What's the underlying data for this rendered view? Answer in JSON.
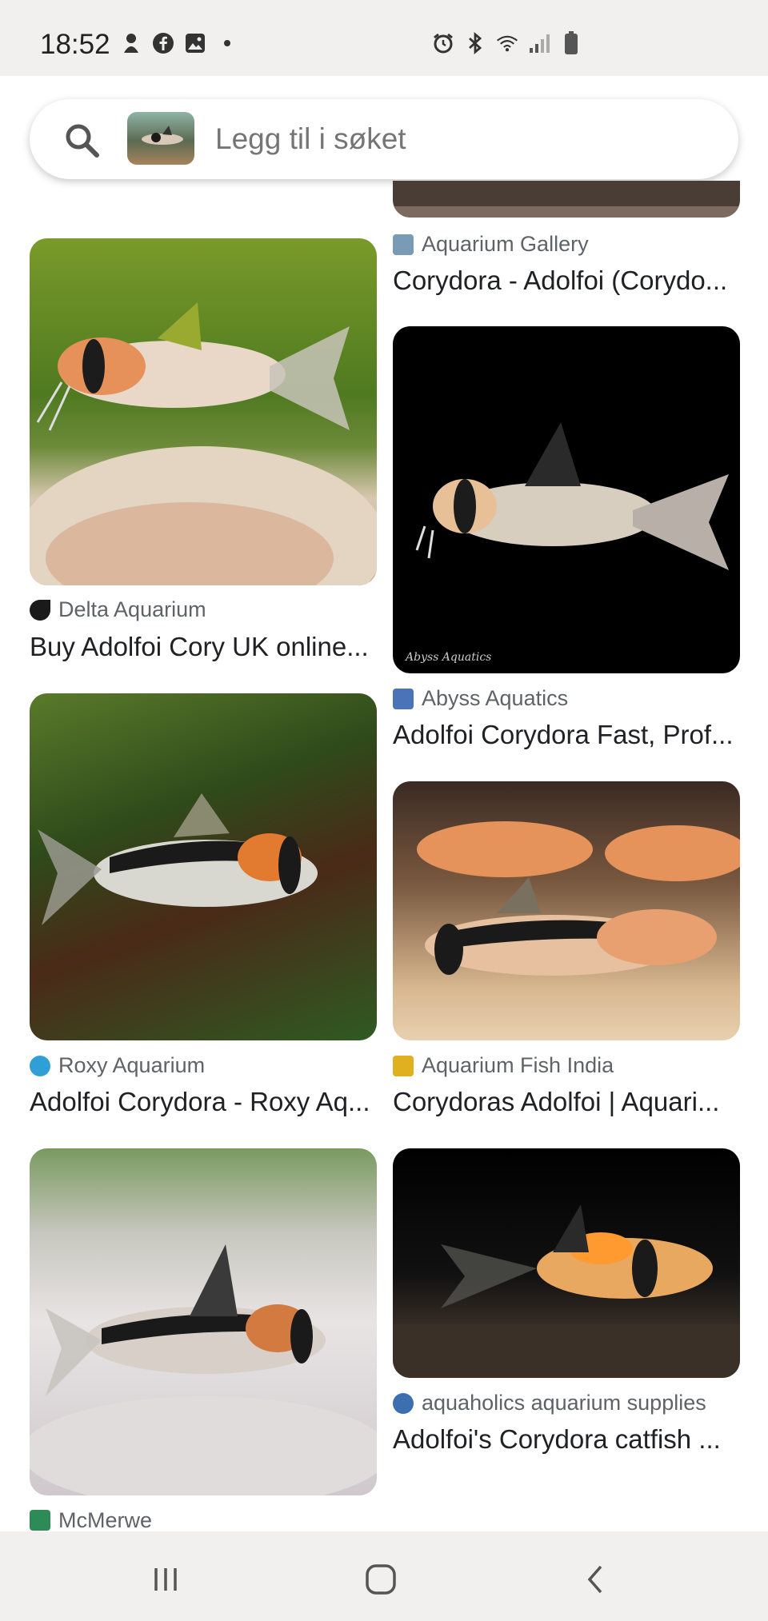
{
  "status_bar": {
    "time": "18:52",
    "left_icons": [
      "notification-icon",
      "facebook-icon",
      "gallery-icon",
      "dot-icon"
    ],
    "right_icons": [
      "alarm-icon",
      "bluetooth-icon",
      "wifi-icon",
      "signal-icon",
      "battery-icon"
    ]
  },
  "search": {
    "placeholder": "Legg til i søket",
    "icon": "search-icon"
  },
  "results": [
    {
      "source": "Aquarium Gallery",
      "title": "Corydora - Adolfoi (Corydo...",
      "favicon_color": "#7a9bb5"
    },
    {
      "source": "Delta Aquarium",
      "title": "Buy Adolfoi Cory UK online...",
      "favicon_color": "#1a1a1a"
    },
    {
      "source": "Abyss Aquatics",
      "title": "Adolfoi Corydora Fast, Prof...",
      "favicon_color": "#4a73b8",
      "watermark": "Abyss Aquatics"
    },
    {
      "source": "Roxy Aquarium",
      "title": "Adolfoi Corydora - Roxy Aq...",
      "favicon_color": "#2f9fd6"
    },
    {
      "source": "Aquarium Fish India",
      "title": "Corydoras Adolfoi | Aquari...",
      "favicon_color": "#e0b020"
    },
    {
      "source": "aquaholics aquarium supplies",
      "title": "Adolfoi's Corydora catfish ...",
      "favicon_color": "#3a6fb0"
    },
    {
      "source": "McMerwe",
      "title": "",
      "favicon_color": "#2e8b57"
    }
  ],
  "nav_bar": {
    "buttons": [
      "recent-apps-icon",
      "home-icon",
      "back-icon"
    ]
  },
  "colors": {
    "status_bg": "#f1f0ee",
    "text_secondary": "#5f6368",
    "text_primary": "#202124"
  }
}
